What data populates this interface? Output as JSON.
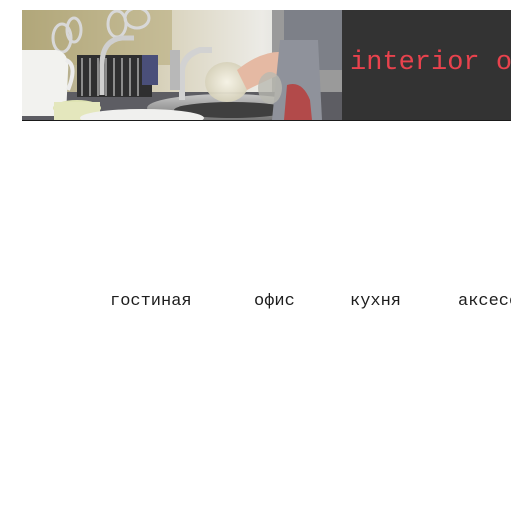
{
  "header": {
    "title": "interior objects"
  },
  "nav": {
    "items": [
      {
        "label": "гостиная"
      },
      {
        "label": "офис"
      },
      {
        "label": "кухня"
      },
      {
        "label": "аксессуары"
      }
    ]
  }
}
